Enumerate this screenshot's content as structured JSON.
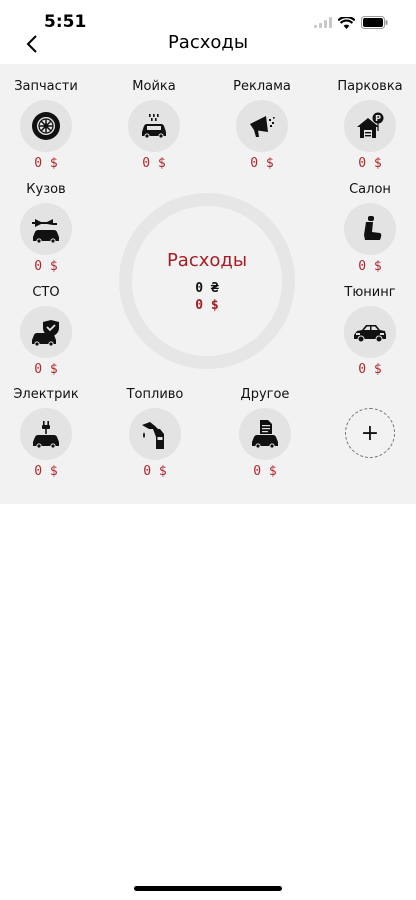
{
  "status_bar": {
    "time": "5:51"
  },
  "header": {
    "title": "Расходы"
  },
  "categories": [
    {
      "label": "Запчасти",
      "amount": "0 $",
      "icon": "tire-icon"
    },
    {
      "label": "Мойка",
      "amount": "0 $",
      "icon": "car-wash-icon"
    },
    {
      "label": "Реклама",
      "amount": "0 $",
      "icon": "megaphone-icon"
    },
    {
      "label": "Парковка",
      "amount": "0 $",
      "icon": "parking-house-icon"
    },
    {
      "label": "Кузов",
      "amount": "0 $",
      "icon": "car-wrench-icon"
    },
    {
      "label": "Салон",
      "amount": "0 $",
      "icon": "car-seat-icon"
    },
    {
      "label": "СТО",
      "amount": "0 $",
      "icon": "car-shield-icon"
    },
    {
      "label": "Тюнинг",
      "amount": "0 $",
      "icon": "sports-car-icon"
    },
    {
      "label": "Электрик",
      "amount": "0 $",
      "icon": "car-plug-icon"
    },
    {
      "label": "Топливо",
      "amount": "0 $",
      "icon": "fuel-nozzle-icon"
    },
    {
      "label": "Другое",
      "amount": "0 $",
      "icon": "car-document-icon"
    }
  ],
  "summary": {
    "title": "Расходы",
    "total_uah": "0 ₴",
    "total_usd": "0 $"
  },
  "add_button": {
    "label": "+"
  }
}
